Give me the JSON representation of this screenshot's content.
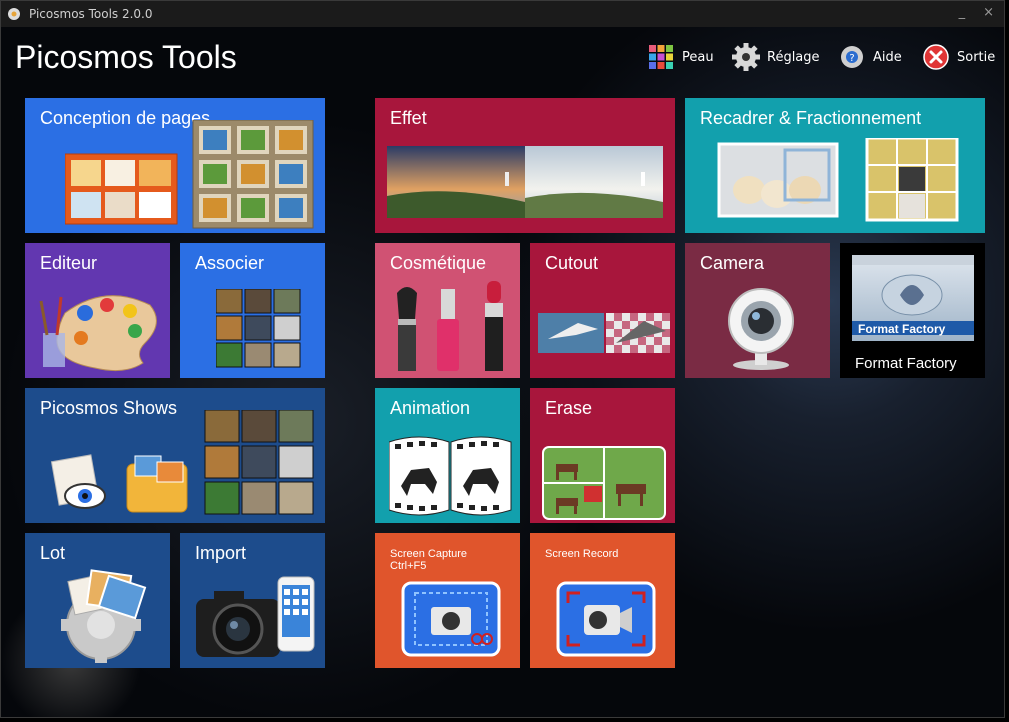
{
  "window": {
    "title": "Picosmos Tools 2.0.0",
    "minimize": "_",
    "close": "×"
  },
  "logo": "Picosmos Tools",
  "toolbar": {
    "skin": "Peau",
    "settings": "Réglage",
    "help": "Aide",
    "exit": "Sortie"
  },
  "tiles": {
    "conception": "Conception de pages",
    "effet": "Effet",
    "recadrer": "Recadrer & Fractionnement",
    "editeur": "Editeur",
    "associer": "Associer",
    "cosmetique": "Cosmétique",
    "cutout": "Cutout",
    "camera": "Camera",
    "format_factory": "Format Factory",
    "format_factory_badge": "Format Factory",
    "shows": "Picosmos Shows",
    "animation": "Animation",
    "erase": "Erase",
    "lot": "Lot",
    "import": "Import",
    "screen_capture": "Screen Capture",
    "screen_capture_hotkey": "Ctrl+F5",
    "screen_record": "Screen Record"
  },
  "colors": {
    "blue": "#2b6fe4",
    "purple": "#6237b0",
    "navy": "#1d4c8c",
    "crimson": "#a8163c",
    "pink": "#d05273",
    "teal": "#12a0ad",
    "maroon": "#7a2b44",
    "orange": "#e0552c",
    "black": "#000000"
  }
}
